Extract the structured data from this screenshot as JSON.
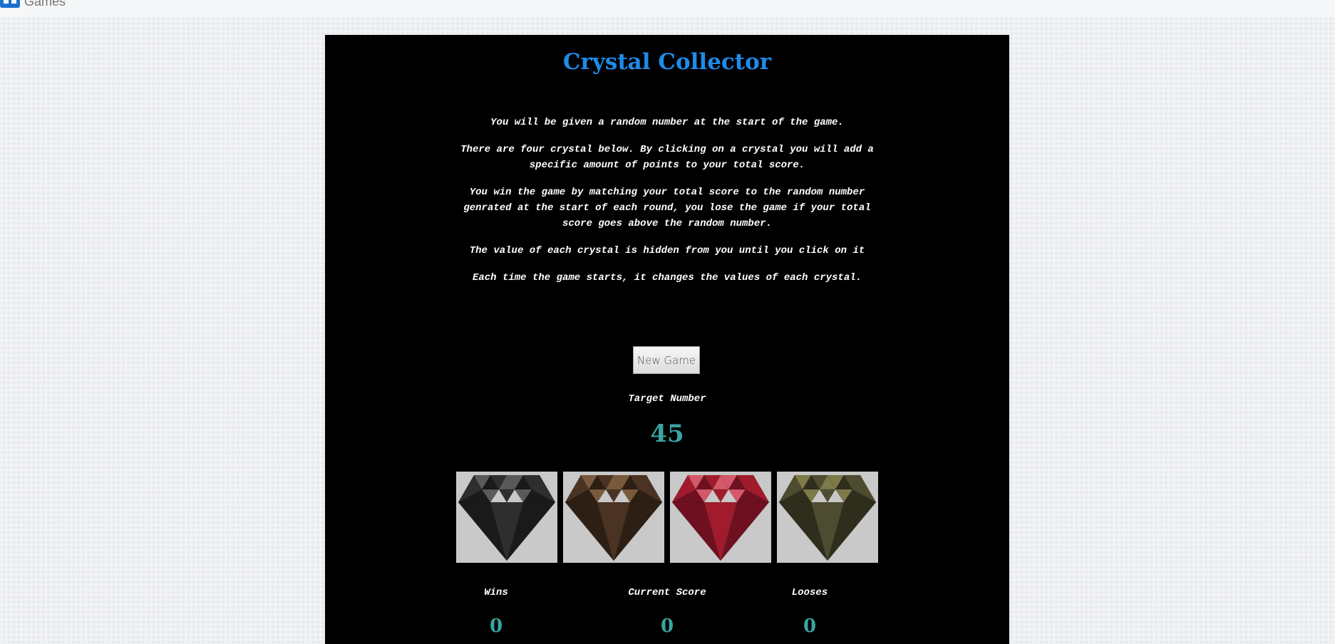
{
  "nav": {
    "brand_label": "Games"
  },
  "game": {
    "title": "Crystal Collector",
    "instructions": [
      "You will be given a random number at the start of the game.",
      "There are four crystal below. By clicking on a crystal you will add a specific amount of points to your total score.",
      "You win the game by matching your total score to the random number genrated at the start of each round, you lose the game if your total score goes above the random number.",
      "The value of each crystal is hidden from you until you click on it",
      "Each time the game starts, it changes the values of each crystal."
    ],
    "new_game_label": "New Game",
    "target_label": "Target Number",
    "target_value": "45",
    "crystals": [
      {
        "name": "black-crystal",
        "color": "#2e2e2e",
        "light": "#5a5a5a",
        "dark": "#1a1a1a"
      },
      {
        "name": "brown-crystal",
        "color": "#4a3322",
        "light": "#7a5a3c",
        "dark": "#2e1f14"
      },
      {
        "name": "red-crystal",
        "color": "#a11b2c",
        "light": "#d4586a",
        "dark": "#6e1020"
      },
      {
        "name": "olive-crystal",
        "color": "#4d4c30",
        "light": "#7d7a4a",
        "dark": "#2f2e1c"
      }
    ],
    "wins_label": "Wins",
    "wins_value": "0",
    "score_label": "Current Score",
    "score_value": "0",
    "looses_label": "Looses",
    "looses_value": "0"
  }
}
